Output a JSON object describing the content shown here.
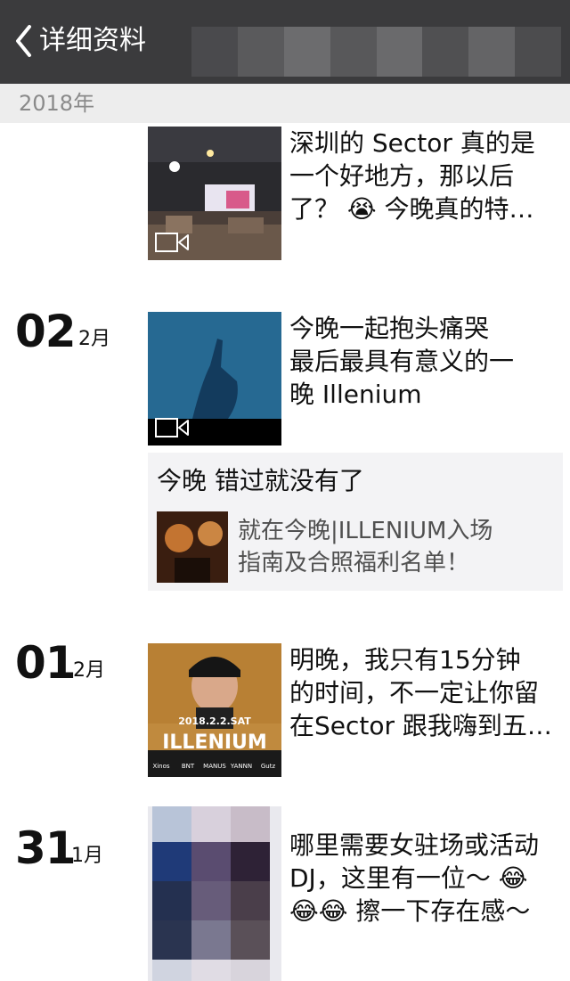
{
  "nav": {
    "back_label": "详细资料"
  },
  "section": {
    "year": "2018年"
  },
  "posts": [
    {
      "text": "深圳的 Sector 真的是\n一个好地方，那以后\n了？ 😭 今晚真的特…"
    },
    {
      "day": "02",
      "month": "2月",
      "text": "今晚一起抱头痛哭\n最后最具有意义的一\n晚 Illenium"
    },
    {
      "day": "01",
      "month": "2月",
      "text": "明晚，我只有15分钟\n的时间，不一定让你留\n在Sector 跟我嗨到五…"
    },
    {
      "day": "31",
      "month": "1月",
      "text": "哪里需要女驻场或活动\nDJ，这里有一位～ 😂\n😂😂 擦一下存在感～"
    }
  ],
  "share": {
    "title": "今晚 错过就没有了",
    "article": "就在今晚|ILLENIUM入场\n指南及合照福利名单！"
  },
  "poster": {
    "date": "2018.2.2.SAT",
    "name": "ILLENIUM",
    "sponsors": [
      "Xinos",
      "BNT",
      "MANUS",
      "YANNN",
      "Gutz"
    ]
  },
  "colors": {
    "navbar": "#3b3b3d",
    "section_bg": "#ededed",
    "card_bg": "#f3f3f5"
  }
}
